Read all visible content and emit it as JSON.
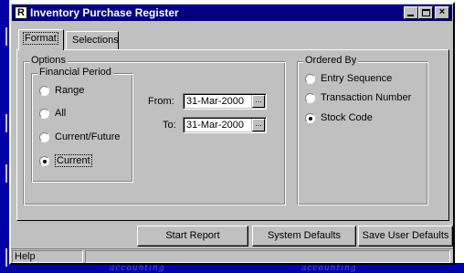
{
  "window": {
    "title": "Inventory Purchase Register",
    "title_icon": "R"
  },
  "tabs": [
    {
      "label": "Format",
      "active": true
    },
    {
      "label": "Selections",
      "active": false
    }
  ],
  "options": {
    "label": "Options",
    "financial_period": {
      "label": "Financial Period",
      "items": [
        {
          "label": "Range",
          "selected": false
        },
        {
          "label": "All",
          "selected": false
        },
        {
          "label": "Current/Future",
          "selected": false
        },
        {
          "label": "Current",
          "selected": true
        }
      ]
    },
    "from_label": "From:",
    "from_value": "31-Mar-2000",
    "to_label": "To:",
    "to_value": "31-Mar-2000",
    "picker_glyph": "..."
  },
  "ordered_by": {
    "label": "Ordered By",
    "items": [
      {
        "label": "Entry Sequence",
        "selected": false
      },
      {
        "label": "Transaction Number",
        "selected": false
      },
      {
        "label": "Stock Code",
        "selected": true
      }
    ]
  },
  "buttons": {
    "start_report": "Start Report",
    "system_defaults": "System Defaults",
    "save_user_defaults": "Save User Defaults"
  },
  "status_bar": {
    "help": "Help"
  },
  "background": {
    "ghost_text_1": "accounting",
    "ghost_text_2": "accounting"
  }
}
